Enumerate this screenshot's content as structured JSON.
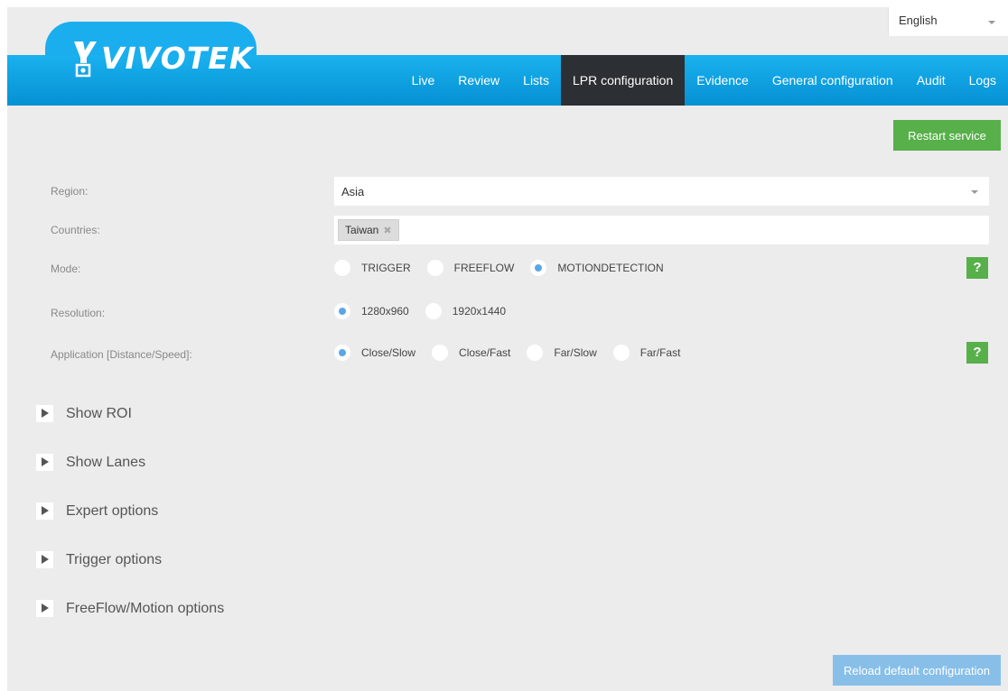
{
  "language": {
    "selected": "English"
  },
  "brand": {
    "logo_text": "VIVOTEK"
  },
  "nav": {
    "items": [
      {
        "label": "Live"
      },
      {
        "label": "Review"
      },
      {
        "label": "Lists"
      },
      {
        "label": "LPR configuration",
        "active": true
      },
      {
        "label": "Evidence"
      },
      {
        "label": "General configuration"
      },
      {
        "label": "Audit"
      },
      {
        "label": "Logs"
      }
    ]
  },
  "actions": {
    "restart_label": "Restart service",
    "reload_label": "Reload default configuration"
  },
  "form": {
    "region": {
      "label": "Region:",
      "value": "Asia"
    },
    "countries": {
      "label": "Countries:",
      "tags": [
        {
          "label": "Taiwan",
          "remove": "✖"
        }
      ]
    },
    "mode": {
      "label": "Mode:",
      "options": [
        {
          "label": "TRIGGER",
          "selected": false
        },
        {
          "label": "FREEFLOW",
          "selected": false
        },
        {
          "label": "MOTIONDETECTION",
          "selected": true
        }
      ],
      "help": "?"
    },
    "resolution": {
      "label": "Resolution:",
      "options": [
        {
          "label": "1280x960",
          "selected": true
        },
        {
          "label": "1920x1440",
          "selected": false
        }
      ]
    },
    "application": {
      "label": "Application [Distance/Speed]:",
      "options": [
        {
          "label": "Close/Slow",
          "selected": true
        },
        {
          "label": "Close/Fast",
          "selected": false
        },
        {
          "label": "Far/Slow",
          "selected": false
        },
        {
          "label": "Far/Fast",
          "selected": false
        }
      ],
      "help": "?"
    }
  },
  "sections": [
    {
      "label": "Show ROI"
    },
    {
      "label": "Show Lanes"
    },
    {
      "label": "Expert options"
    },
    {
      "label": "Trigger options"
    },
    {
      "label": "FreeFlow/Motion options"
    }
  ],
  "colors": {
    "header": "#0a9be0",
    "nav_active": "#2c2f33",
    "green_button": "#57b04a",
    "blue_button": "#88bfe9",
    "radio_selected": "#5aa7e6",
    "background": "#ececec"
  }
}
